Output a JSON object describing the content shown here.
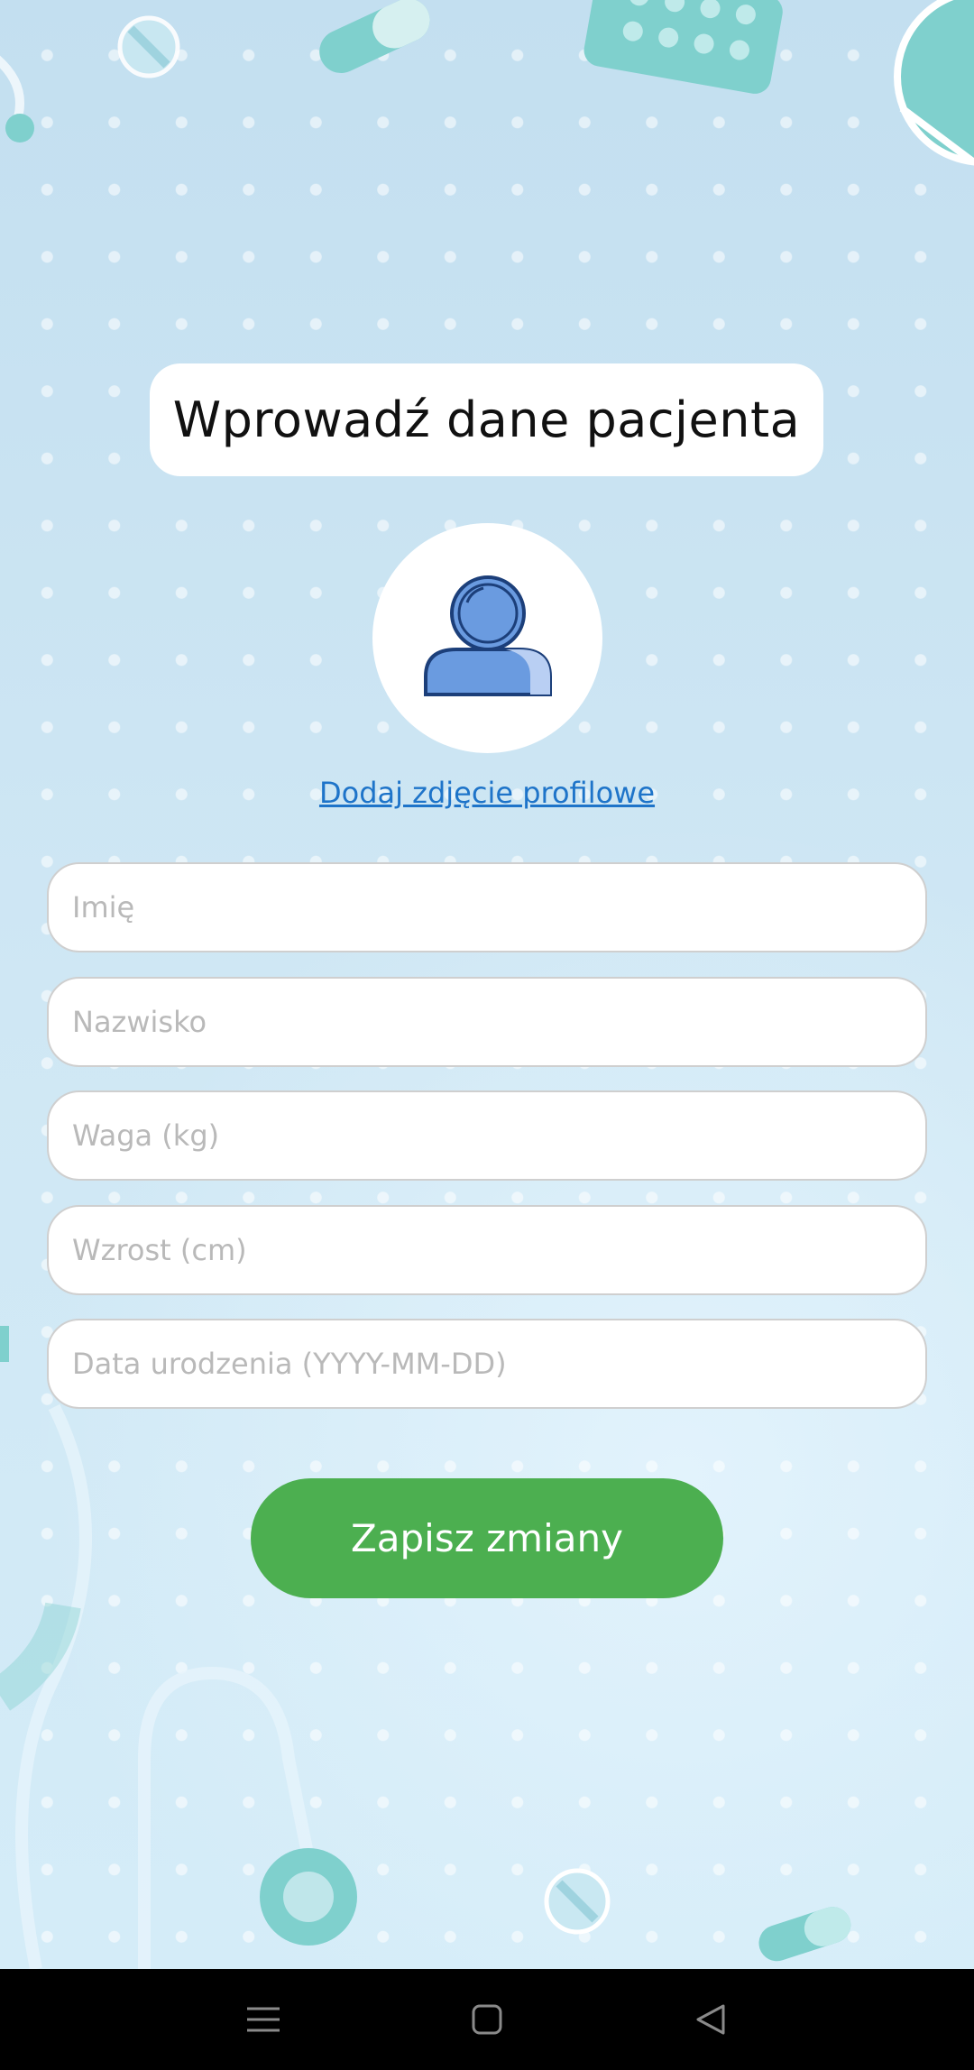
{
  "header": {
    "title": "Wprowadź dane pacjenta"
  },
  "profile": {
    "add_photo_link": "Dodaj zdjęcie profilowe",
    "avatar_icon": "user-avatar-icon"
  },
  "form": {
    "first_name": {
      "placeholder": "Imię",
      "value": ""
    },
    "last_name": {
      "placeholder": "Nazwisko",
      "value": ""
    },
    "weight": {
      "placeholder": "Waga (kg)",
      "value": ""
    },
    "height": {
      "placeholder": "Wzrost (cm)",
      "value": ""
    },
    "birth_date": {
      "placeholder": "Data urodzenia (YYYY-MM-DD)",
      "value": ""
    }
  },
  "actions": {
    "save_label": "Zapisz zmiany"
  },
  "navbar": {
    "items": [
      "menu-icon",
      "home-icon",
      "back-icon"
    ]
  },
  "colors": {
    "background": "#c6e1f0",
    "accent_green": "#4caf50",
    "link_blue": "#1e74c9",
    "avatar_blue": "#6a9be0"
  }
}
